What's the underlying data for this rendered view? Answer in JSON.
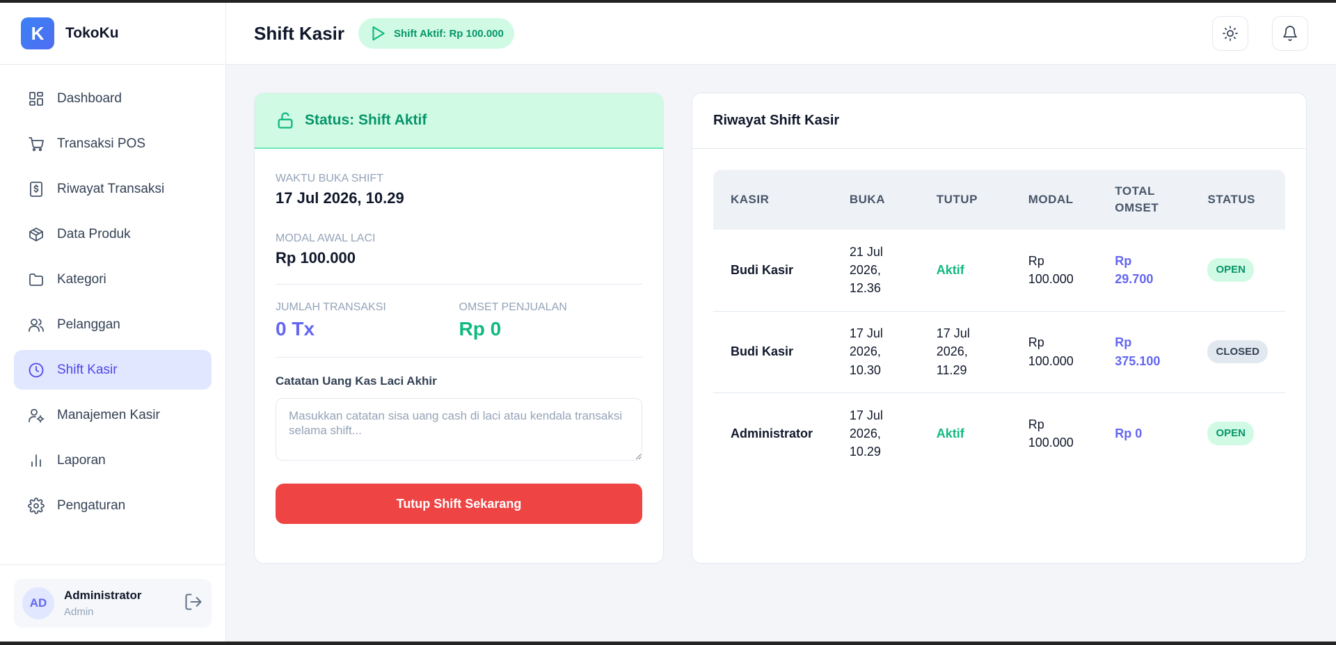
{
  "app": {
    "logo_letter": "K",
    "name": "TokoKu"
  },
  "sidebar": {
    "items": [
      {
        "label": "Dashboard",
        "icon": "dashboard-icon"
      },
      {
        "label": "Transaksi POS",
        "icon": "cart-icon"
      },
      {
        "label": "Riwayat Transaksi",
        "icon": "receipt-icon"
      },
      {
        "label": "Data Produk",
        "icon": "box-icon"
      },
      {
        "label": "Kategori",
        "icon": "folder-icon"
      },
      {
        "label": "Pelanggan",
        "icon": "users-icon"
      },
      {
        "label": "Shift Kasir",
        "icon": "clock-icon",
        "active": true
      },
      {
        "label": "Manajemen Kasir",
        "icon": "user-cog-icon"
      },
      {
        "label": "Laporan",
        "icon": "bar-chart-icon"
      },
      {
        "label": "Pengaturan",
        "icon": "gear-icon"
      }
    ],
    "user": {
      "initials": "AD",
      "name": "Administrator",
      "role": "Admin"
    }
  },
  "header": {
    "title": "Shift Kasir",
    "badge": "Shift Aktif: Rp 100.000"
  },
  "shift_card": {
    "status": "Status: Shift Aktif",
    "open_time_label": "WAKTU BUKA SHIFT",
    "open_time_value": "17 Jul 2026, 10.29",
    "modal_label": "MODAL AWAL LACI",
    "modal_value": "Rp 100.000",
    "tx_label": "JUMLAH TRANSAKSI",
    "tx_value": "0 Tx",
    "omset_label": "OMSET PENJUALAN",
    "omset_value": "Rp 0",
    "note_label": "Catatan Uang Kas Laci Akhir",
    "note_placeholder": "Masukkan catatan sisa uang cash di laci atau kendala transaksi selama shift...",
    "close_button": "Tutup Shift Sekarang"
  },
  "history": {
    "title": "Riwayat Shift Kasir",
    "columns": [
      "KASIR",
      "BUKA",
      "TUTUP",
      "MODAL",
      "TOTAL OMSET",
      "STATUS"
    ],
    "rows": [
      {
        "kasir": "Budi Kasir",
        "buka": "21 Jul 2026, 12.36",
        "tutup": "Aktif",
        "modal": "Rp 100.000",
        "omset": "Rp 29.700",
        "status": "OPEN"
      },
      {
        "kasir": "Budi Kasir",
        "buka": "17 Jul 2026, 10.30",
        "tutup": "17 Jul 2026, 11.29",
        "modal": "Rp 100.000",
        "omset": "Rp 375.100",
        "status": "CLOSED"
      },
      {
        "kasir": "Administrator",
        "buka": "17 Jul 2026, 10.29",
        "tutup": "Aktif",
        "modal": "Rp 100.000",
        "omset": "Rp 0",
        "status": "OPEN"
      }
    ]
  },
  "colors": {
    "accent": "#4f46e5",
    "success": "#10b981",
    "danger": "#ef4444"
  }
}
